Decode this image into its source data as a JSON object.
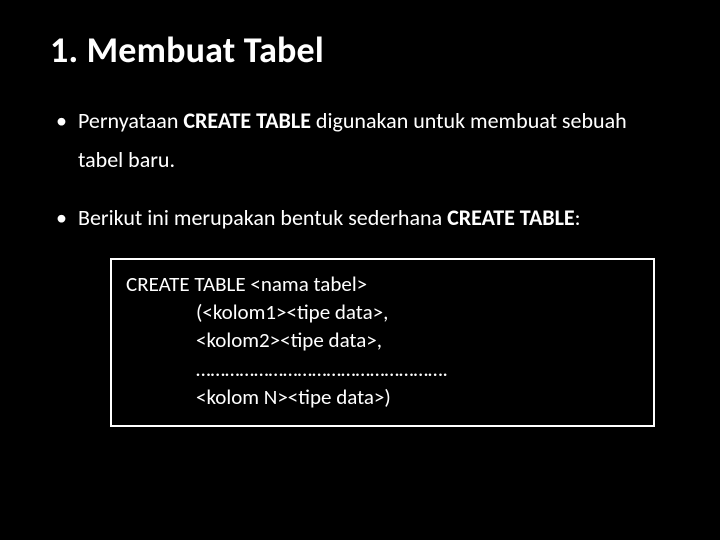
{
  "title": "1. Membuat Tabel",
  "bullet1": {
    "pre": "Pernyataan ",
    "strong": "CREATE TABLE",
    "post": " digunakan untuk membuat sebuah tabel baru."
  },
  "bullet2": {
    "pre": "Berikut ini merupakan bentuk sederhana ",
    "strong": "CREATE TABLE",
    "post": ":"
  },
  "code": {
    "l1": "CREATE TABLE <nama tabel>",
    "l2": "(<kolom1><tipe data>,",
    "l3": "<kolom2><tipe data>,",
    "l4": "…………………………………………….",
    "l5": "<kolom N><tipe data>)"
  }
}
